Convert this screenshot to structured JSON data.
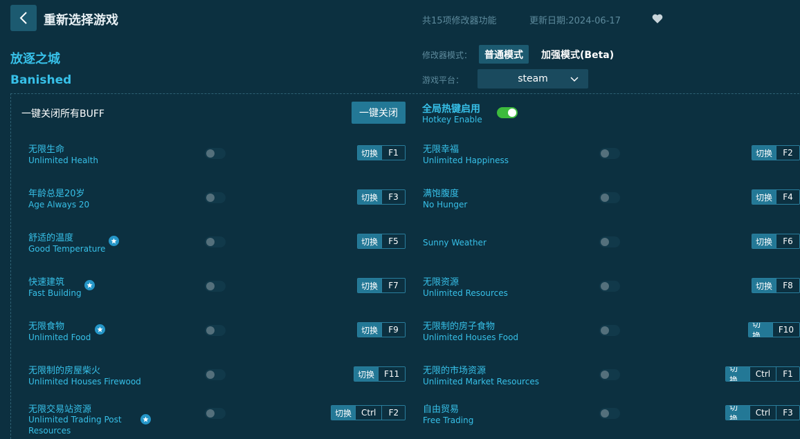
{
  "header": {
    "title": "重新选择游戏",
    "feature_count": "共15项修改器功能",
    "update_date": "更新日期:2024-06-17"
  },
  "game": {
    "name_cn": "放逐之城",
    "name_en": "Banished"
  },
  "mode": {
    "label": "修改器模式：",
    "normal": "普通模式",
    "beta": "加强模式(Beta)"
  },
  "platform": {
    "label": "游戏平台：",
    "value": "steam"
  },
  "controls": {
    "all_off_label": "一键关闭所有BUFF",
    "all_off_button": "一键关闭",
    "hotkey_cn": "全局热键启用",
    "hotkey_en": "Hotkey Enable",
    "hotkey_enabled": true
  },
  "switch_label": "切换",
  "cheats": [
    {
      "cn": "无限生命",
      "en": "Unlimited Health",
      "keys": [
        "F1"
      ],
      "star": false,
      "on": false
    },
    {
      "cn": "无限幸福",
      "en": "Unlimited Happiness",
      "keys": [
        "F2"
      ],
      "star": false,
      "on": false
    },
    {
      "cn": "年龄总是20岁",
      "en": "Age Always 20",
      "keys": [
        "F3"
      ],
      "star": false,
      "on": false
    },
    {
      "cn": "满饱腹度",
      "en": "No Hunger",
      "keys": [
        "F4"
      ],
      "star": false,
      "on": false
    },
    {
      "cn": "舒适的温度",
      "en": "Good Temperature",
      "keys": [
        "F5"
      ],
      "star": true,
      "on": false
    },
    {
      "cn": "",
      "en": "Sunny Weather",
      "keys": [
        "F6"
      ],
      "star": false,
      "on": false
    },
    {
      "cn": "快速建筑",
      "en": "Fast Building",
      "keys": [
        "F7"
      ],
      "star": true,
      "on": false
    },
    {
      "cn": "无限资源",
      "en": "Unlimited Resources",
      "keys": [
        "F8"
      ],
      "star": false,
      "on": false
    },
    {
      "cn": "无限食物",
      "en": "Unlimited Food",
      "keys": [
        "F9"
      ],
      "star": true,
      "on": false
    },
    {
      "cn": "无限制的房子食物",
      "en": "Unlimited Houses Food",
      "keys": [
        "F10"
      ],
      "star": false,
      "on": false
    },
    {
      "cn": "无限制的房屋柴火",
      "en": "Unlimited Houses Firewood",
      "keys": [
        "F11"
      ],
      "star": false,
      "on": false
    },
    {
      "cn": "无限的市场资源",
      "en": "Unlimited Market Resources",
      "keys": [
        "Ctrl",
        "F1"
      ],
      "star": false,
      "on": false
    },
    {
      "cn": "无限交易站资源",
      "en": "Unlimited Trading Post Resources",
      "keys": [
        "Ctrl",
        "F2"
      ],
      "star": true,
      "on": false
    },
    {
      "cn": "自由贸易",
      "en": "Free Trading",
      "keys": [
        "Ctrl",
        "F3"
      ],
      "star": false,
      "on": false
    }
  ]
}
